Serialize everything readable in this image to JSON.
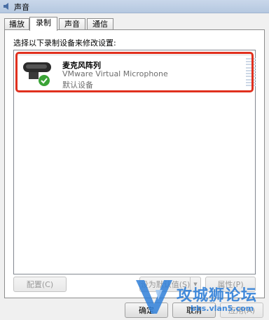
{
  "window": {
    "title": "声音"
  },
  "tabs": [
    {
      "label": "播放"
    },
    {
      "label": "录制"
    },
    {
      "label": "声音"
    },
    {
      "label": "通信"
    }
  ],
  "instruction": "选择以下录制设备来修改设置:",
  "devices": [
    {
      "name": "麦克风阵列",
      "description": "VMware Virtual Microphone",
      "status": "默认设备",
      "default": true
    }
  ],
  "buttons": {
    "configure": "配置(C)",
    "set_default": "设为默认值(S)",
    "properties": "属性(P)",
    "ok": "确定",
    "cancel": "取消",
    "apply": "应用(A)"
  },
  "watermark": {
    "text": "攻城狮论坛",
    "url": "bbs.vlan5.com"
  },
  "colors": {
    "highlight": "#e0301e",
    "accent": "#2f7fd8",
    "check": "#3aa336"
  }
}
